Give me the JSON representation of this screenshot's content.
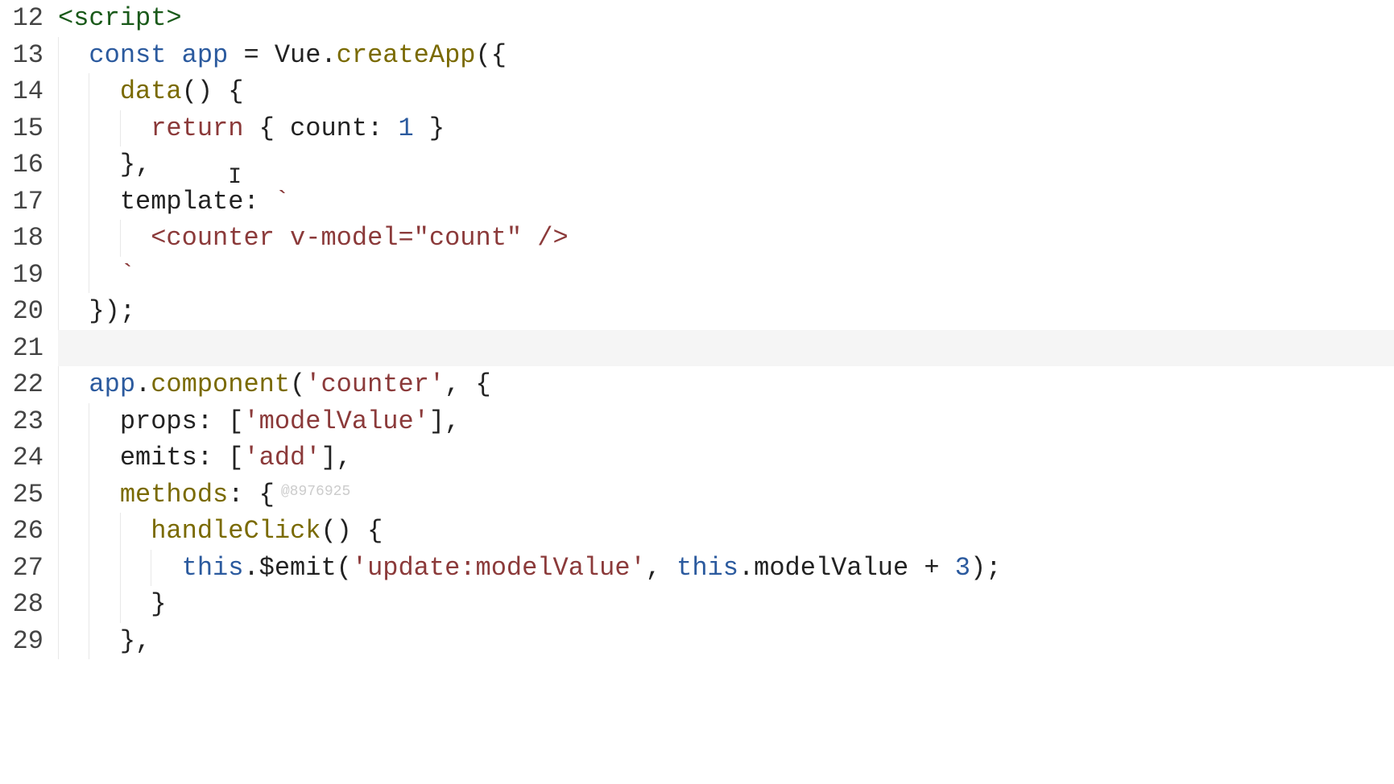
{
  "gutter": {
    "start": 12,
    "end": 29
  },
  "currentLine": 21,
  "watermark": "@8976925",
  "lines": [
    {
      "n": 12,
      "indent": 0,
      "tokens": [
        {
          "t": "<script>",
          "c": "tok-tag"
        }
      ]
    },
    {
      "n": 13,
      "indent": 2,
      "tokens": [
        {
          "t": "const",
          "c": "tok-kw"
        },
        {
          "t": " ",
          "c": "tok-plain"
        },
        {
          "t": "app",
          "c": "tok-decl"
        },
        {
          "t": " = Vue.",
          "c": "tok-plain"
        },
        {
          "t": "createApp",
          "c": "tok-func"
        },
        {
          "t": "({",
          "c": "tok-plain"
        }
      ]
    },
    {
      "n": 14,
      "indent": 4,
      "tokens": [
        {
          "t": "data",
          "c": "tok-prop"
        },
        {
          "t": "() {",
          "c": "tok-plain"
        }
      ]
    },
    {
      "n": 15,
      "indent": 6,
      "tokens": [
        {
          "t": "return",
          "c": "tok-return"
        },
        {
          "t": " { count: ",
          "c": "tok-plain"
        },
        {
          "t": "1",
          "c": "tok-num"
        },
        {
          "t": " }",
          "c": "tok-plain"
        }
      ]
    },
    {
      "n": 16,
      "indent": 4,
      "tokens": [
        {
          "t": "},",
          "c": "tok-plain"
        }
      ],
      "cursorAfter": true,
      "cursorOffset": "     "
    },
    {
      "n": 17,
      "indent": 4,
      "tokens": [
        {
          "t": "template:",
          "c": "tok-plain"
        },
        {
          "t": " ",
          "c": "tok-plain"
        },
        {
          "t": "`",
          "c": "tok-str"
        }
      ]
    },
    {
      "n": 18,
      "indent": 6,
      "tokens": [
        {
          "t": "<counter v-model=\"count\" />",
          "c": "tok-str"
        }
      ]
    },
    {
      "n": 19,
      "indent": 4,
      "tokens": [
        {
          "t": "`",
          "c": "tok-str"
        }
      ]
    },
    {
      "n": 20,
      "indent": 2,
      "tokens": [
        {
          "t": "});",
          "c": "tok-plain"
        }
      ]
    },
    {
      "n": 21,
      "indent": 0,
      "tokens": []
    },
    {
      "n": 22,
      "indent": 2,
      "tokens": [
        {
          "t": "app",
          "c": "tok-decl"
        },
        {
          "t": ".",
          "c": "tok-plain"
        },
        {
          "t": "component",
          "c": "tok-func"
        },
        {
          "t": "(",
          "c": "tok-plain"
        },
        {
          "t": "'counter'",
          "c": "tok-str"
        },
        {
          "t": ", {",
          "c": "tok-plain"
        }
      ]
    },
    {
      "n": 23,
      "indent": 4,
      "tokens": [
        {
          "t": "props: [",
          "c": "tok-plain"
        },
        {
          "t": "'modelValue'",
          "c": "tok-str"
        },
        {
          "t": "],",
          "c": "tok-plain"
        }
      ]
    },
    {
      "n": 24,
      "indent": 4,
      "tokens": [
        {
          "t": "emits: [",
          "c": "tok-plain"
        },
        {
          "t": "'add'",
          "c": "tok-str"
        },
        {
          "t": "],",
          "c": "tok-plain"
        }
      ]
    },
    {
      "n": 25,
      "indent": 4,
      "tokens": [
        {
          "t": "methods",
          "c": "tok-prop"
        },
        {
          "t": ": {",
          "c": "tok-plain"
        }
      ],
      "watermark": true
    },
    {
      "n": 26,
      "indent": 6,
      "tokens": [
        {
          "t": "handleClick",
          "c": "tok-method"
        },
        {
          "t": "() {",
          "c": "tok-plain"
        }
      ]
    },
    {
      "n": 27,
      "indent": 8,
      "tokens": [
        {
          "t": "this",
          "c": "tok-this"
        },
        {
          "t": ".$emit(",
          "c": "tok-plain"
        },
        {
          "t": "'update:modelValue'",
          "c": "tok-str"
        },
        {
          "t": ", ",
          "c": "tok-plain"
        },
        {
          "t": "this",
          "c": "tok-this"
        },
        {
          "t": ".modelValue + ",
          "c": "tok-plain"
        },
        {
          "t": "3",
          "c": "tok-num"
        },
        {
          "t": ");",
          "c": "tok-plain"
        }
      ]
    },
    {
      "n": 28,
      "indent": 6,
      "tokens": [
        {
          "t": "}",
          "c": "tok-plain"
        }
      ]
    },
    {
      "n": 29,
      "indent": 4,
      "tokens": [
        {
          "t": "},",
          "c": "tok-plain"
        }
      ]
    }
  ]
}
